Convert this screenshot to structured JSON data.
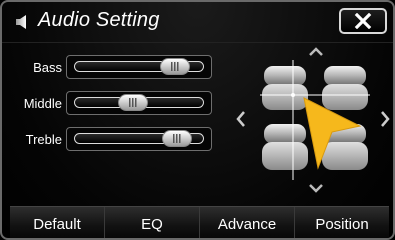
{
  "header": {
    "title": "Audio Setting",
    "icon": "speaker-icon",
    "close_icon": "close-icon"
  },
  "sliders": [
    {
      "label": "Bass",
      "level_percent": 78
    },
    {
      "label": "Middle",
      "level_percent": 45
    },
    {
      "label": "Treble",
      "level_percent": 79
    }
  ],
  "balance": {
    "icons": [
      "arrow-up-icon",
      "arrow-down-icon",
      "arrow-left-icon",
      "arrow-right-icon",
      "seats-icon",
      "pointer-icon"
    ],
    "accent_color": "#f6b81c"
  },
  "tabs": [
    "Default",
    "EQ",
    "Advance",
    "Position"
  ]
}
